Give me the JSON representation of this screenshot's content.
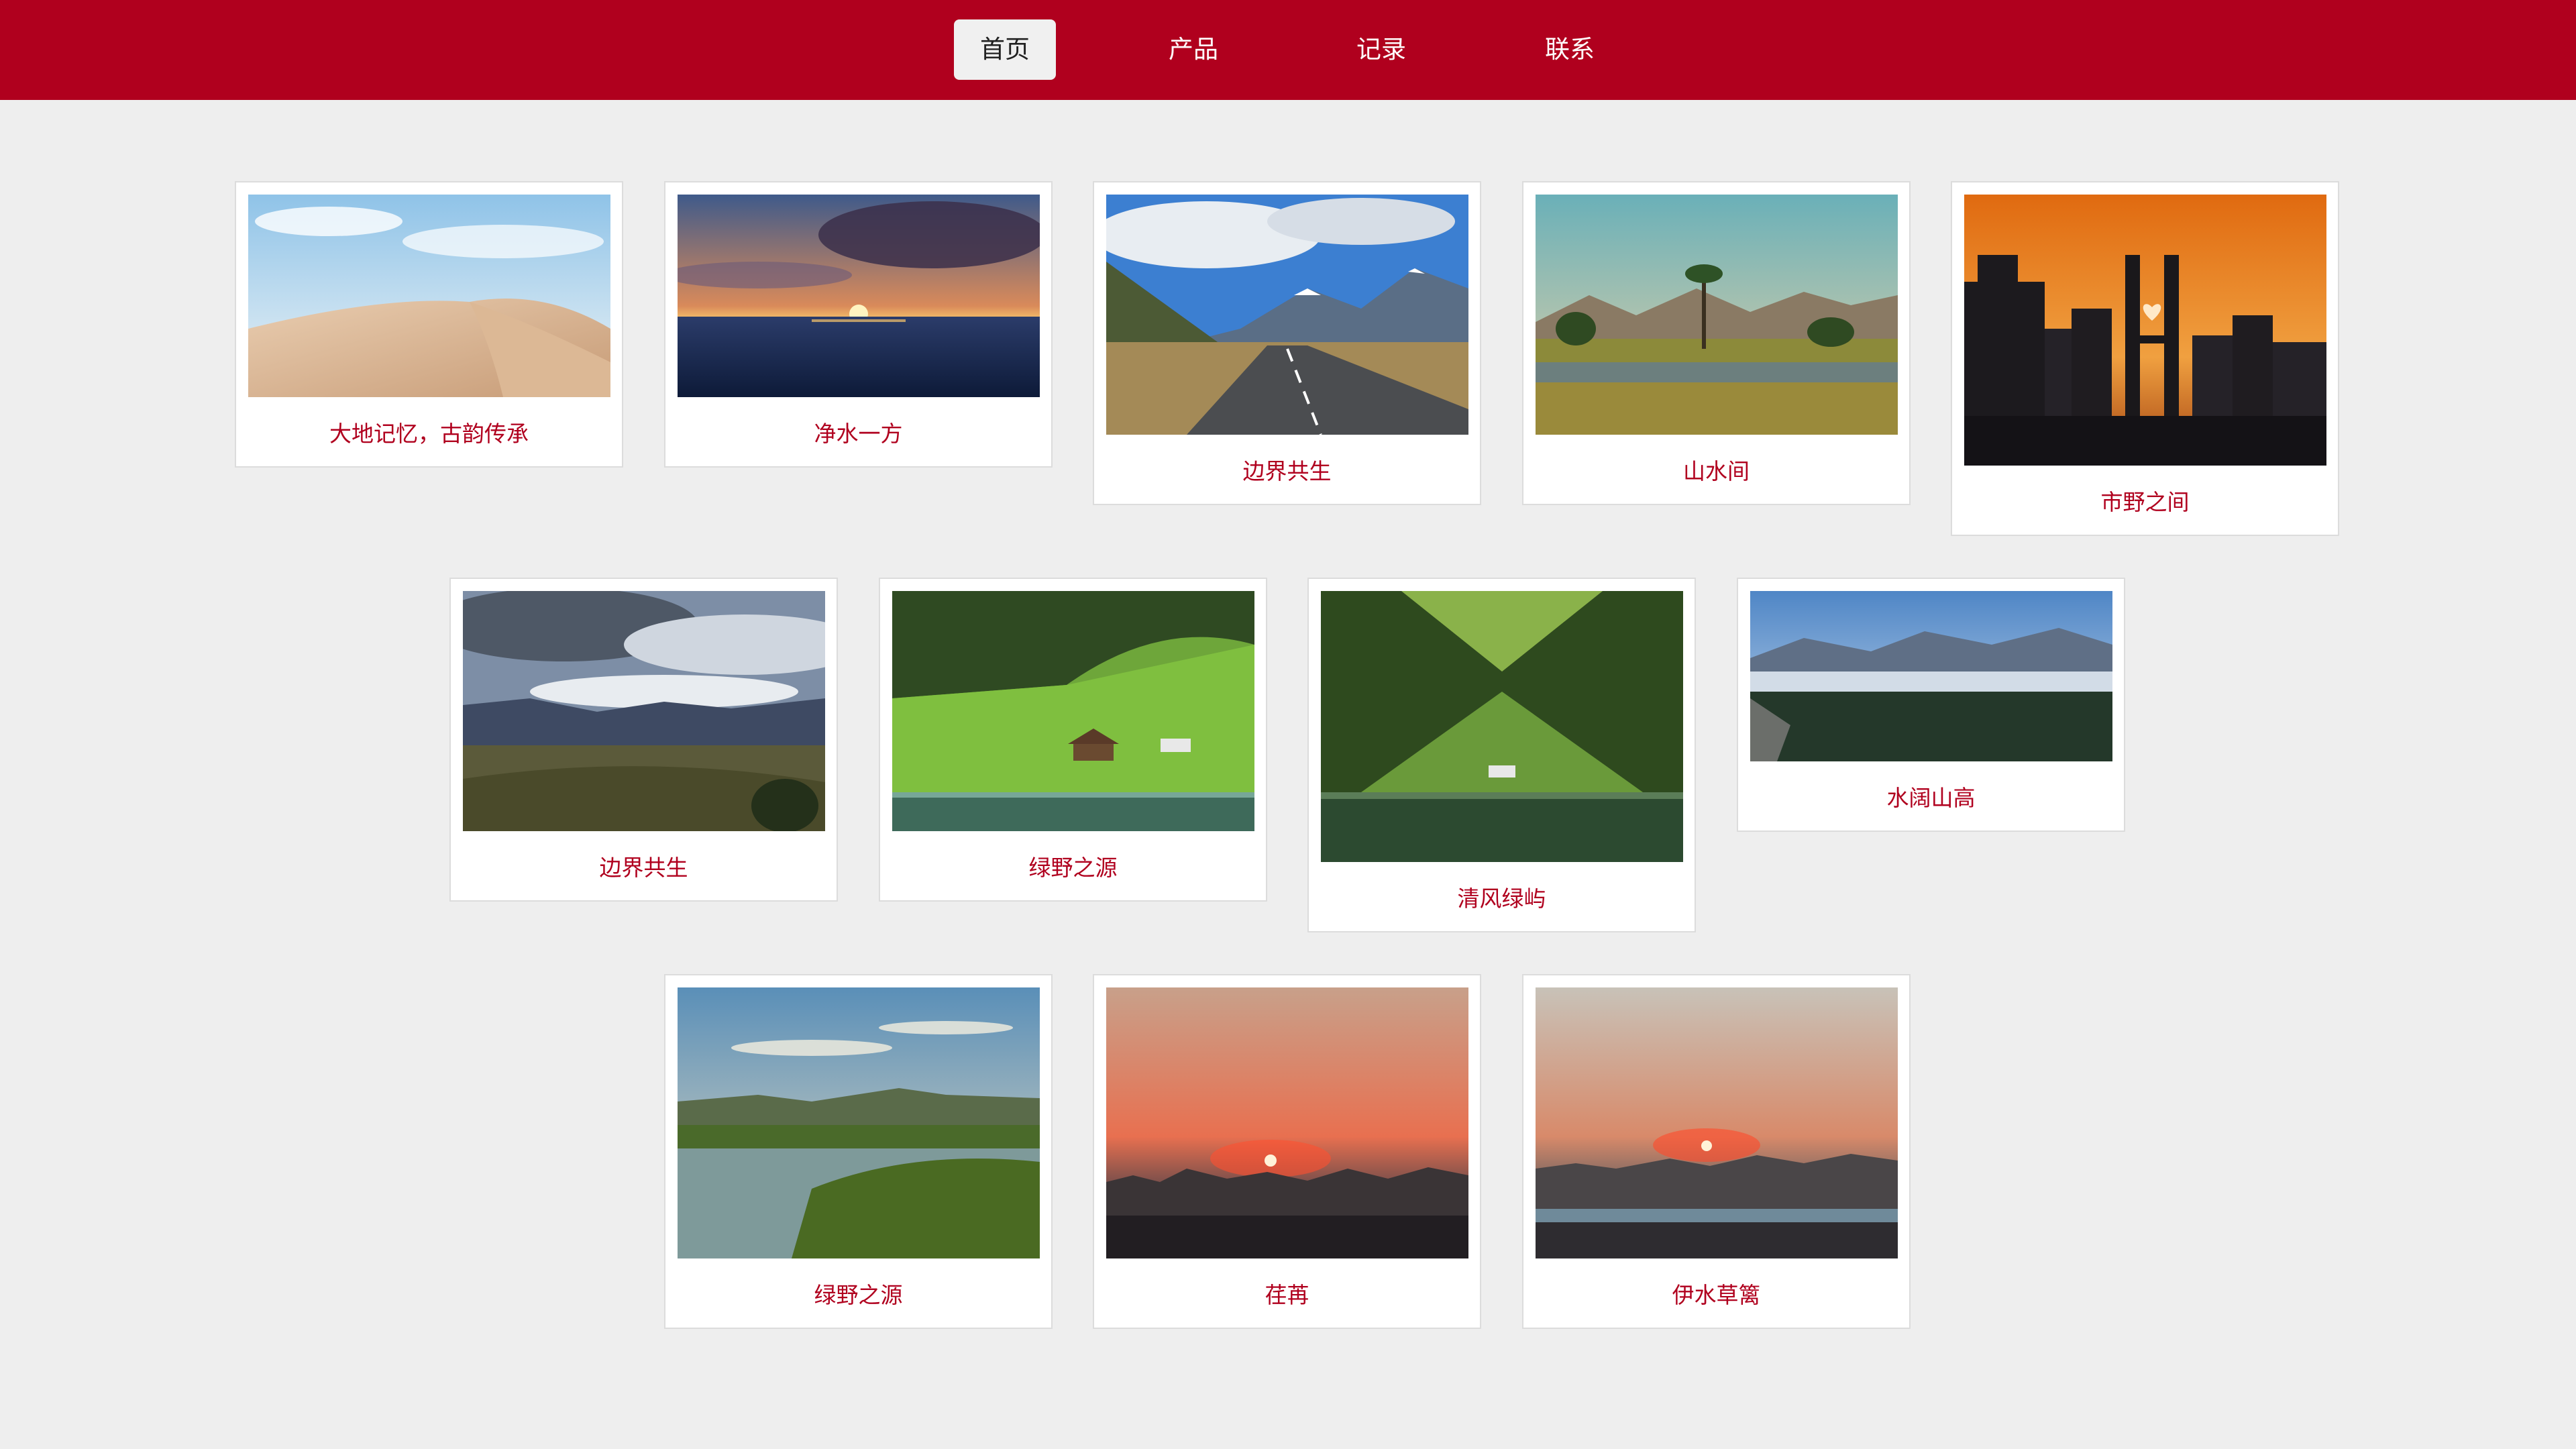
{
  "nav": {
    "items": [
      {
        "label": "首页",
        "active": true
      },
      {
        "label": "产品",
        "active": false
      },
      {
        "label": "记录",
        "active": false
      },
      {
        "label": "联系",
        "active": false
      }
    ]
  },
  "gallery": {
    "cards": [
      {
        "caption": "大地记忆，古韵传承",
        "scene": "desert-dunes"
      },
      {
        "caption": "净水一方",
        "scene": "ocean-sunset"
      },
      {
        "caption": "边界共生",
        "scene": "mountain-road"
      },
      {
        "caption": "山水间",
        "scene": "palm-valley-lake"
      },
      {
        "caption": "市野之间",
        "scene": "city-sunset-heart"
      },
      {
        "caption": "边界共生",
        "scene": "cloudy-valley"
      },
      {
        "caption": "绿野之源",
        "scene": "green-meadow-cabin"
      },
      {
        "caption": "清风绿屿",
        "scene": "green-valley-lake"
      },
      {
        "caption": "水阔山高",
        "scene": "misty-forest-canyon"
      },
      {
        "caption": "绿野之源",
        "scene": "river-pasture-painting"
      },
      {
        "caption": "荏苒",
        "scene": "red-sunset-skyline"
      },
      {
        "caption": "伊水草篱",
        "scene": "sunset-city-river"
      }
    ]
  }
}
